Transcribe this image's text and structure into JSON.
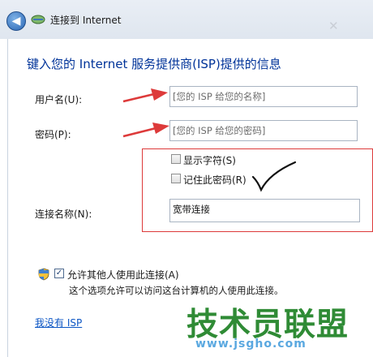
{
  "window": {
    "title": "连接到 Internet",
    "back_glyph": "◀",
    "close_glyph": "✕"
  },
  "form": {
    "heading": "键入您的 Internet 服务提供商(ISP)提供的信息",
    "username_label": "用户名(U):",
    "username_placeholder": "[您的 ISP 给您的名称]",
    "password_label": "密码(P):",
    "password_placeholder": "[您的 ISP 给您的密码]",
    "show_chars_label": "显示字符(S)",
    "show_chars_checked": false,
    "remember_label": "记住此密码(R)",
    "remember_checked": false,
    "connection_name_label": "连接名称(N):",
    "connection_name_value": "宽带连接",
    "allow_others_label": "允许其他人使用此连接(A)",
    "allow_others_checked": true,
    "allow_others_desc": "这个选项允许可以访问这台计算机的人使用此连接。",
    "no_isp_link": "我没有 ISP"
  },
  "watermark": {
    "main": "技术员联盟",
    "url": "www.jsgho.com"
  },
  "colors": {
    "heading": "#003399",
    "link": "#0b55c4",
    "annotation_red": "#dd3a3a",
    "watermark_green": "#2f8b35"
  }
}
